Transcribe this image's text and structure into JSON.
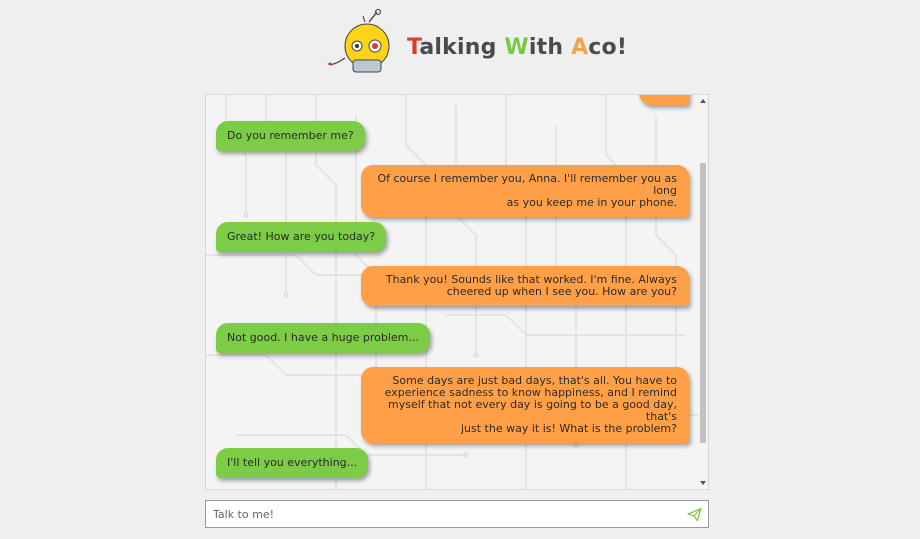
{
  "header": {
    "title_parts": {
      "t": "T",
      "alking": "alking ",
      "w": "W",
      "ith": "ith ",
      "a": "A",
      "co": "co!"
    },
    "logo_icon": "robot-mascot-icon"
  },
  "chat": {
    "messages": [
      {
        "sender": "user",
        "text": "Do you remember me?"
      },
      {
        "sender": "bot",
        "lines": [
          "Of course I remember you, Anna. I'll remember you as long",
          "as you keep me in your phone."
        ]
      },
      {
        "sender": "user",
        "text": "Great! How are you today?"
      },
      {
        "sender": "bot",
        "lines": [
          "Thank you! Sounds like that worked. I'm fine. Always",
          "cheered up when I see you. How are you?"
        ]
      },
      {
        "sender": "user",
        "text": "Not good. I have a huge problem..."
      },
      {
        "sender": "bot",
        "lines": [
          "Some days are just bad days, that's all. You have to",
          "experience sadness to know happiness, and I remind",
          "myself that not every day is going to be a good day, that's",
          "just the way it is! What is the problem?"
        ]
      },
      {
        "sender": "user",
        "text": "I'll tell you everything..."
      }
    ]
  },
  "input": {
    "placeholder": "Talk to me!",
    "value": "",
    "send_icon": "paper-plane-icon"
  },
  "colors": {
    "user_bubble": "#7ccc45",
    "bot_bubble": "#ffa048",
    "title_t": "#e03a2f",
    "title_w": "#7ac943",
    "title_a": "#f7a24a",
    "background": "#efefef"
  }
}
